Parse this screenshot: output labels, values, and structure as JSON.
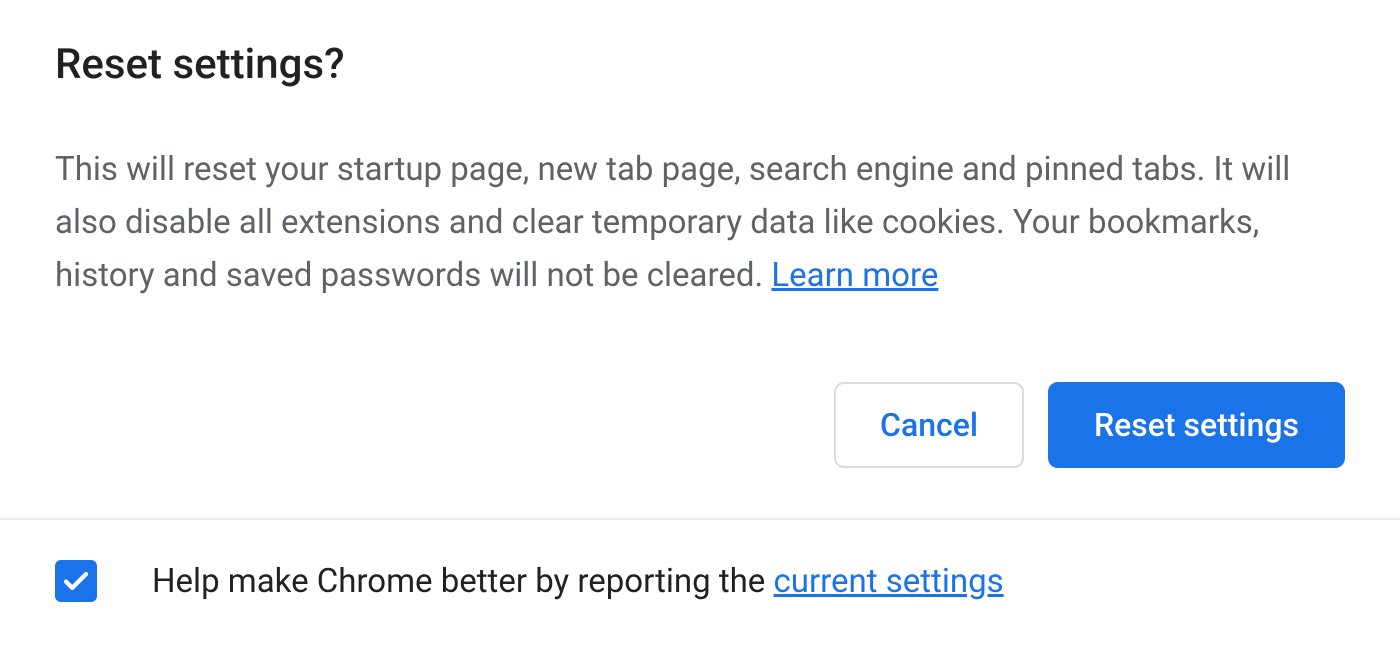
{
  "dialog": {
    "title": "Reset settings?",
    "body_text": "This will reset your startup page, new tab page, search engine and pinned tabs. It will also disable all extensions and clear temporary data like cookies. Your bookmarks, history and saved passwords will not be cleared.  ",
    "learn_more": "Learn more",
    "buttons": {
      "cancel": "Cancel",
      "confirm": "Reset settings"
    }
  },
  "footer": {
    "checkbox_checked": true,
    "text_prefix": "Help make Chrome better by reporting the ",
    "link_text": "current settings"
  }
}
